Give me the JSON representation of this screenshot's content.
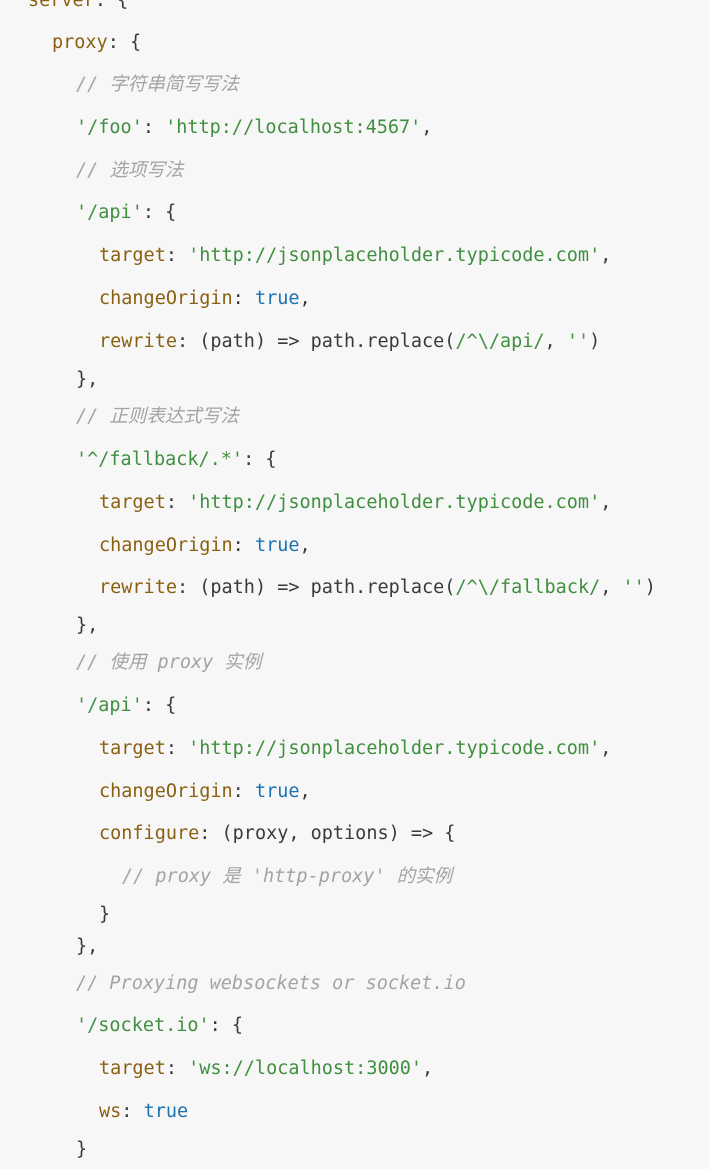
{
  "code": {
    "lines": [
      {
        "indent": 1,
        "tokens": [
          [
            "prop",
            "server"
          ],
          [
            "punc",
            ": {"
          ]
        ]
      },
      {
        "indent": 2,
        "tokens": [
          [
            "prop",
            "proxy"
          ],
          [
            "punc",
            ": {"
          ]
        ]
      },
      {
        "indent": 3,
        "tokens": [
          [
            "cmt",
            "// 字符串简写写法"
          ]
        ]
      },
      {
        "indent": 3,
        "tokens": [
          [
            "str",
            "'/foo'"
          ],
          [
            "punc",
            ": "
          ],
          [
            "str",
            "'http://localhost:4567'"
          ],
          [
            "punc",
            ","
          ]
        ]
      },
      {
        "indent": 3,
        "tokens": [
          [
            "cmt",
            "// 选项写法"
          ]
        ]
      },
      {
        "indent": 3,
        "tokens": [
          [
            "str",
            "'/api'"
          ],
          [
            "punc",
            ": {"
          ]
        ]
      },
      {
        "indent": 4,
        "tokens": [
          [
            "prop",
            "target"
          ],
          [
            "punc",
            ": "
          ],
          [
            "str",
            "'http://jsonplaceholder.typicode.com'"
          ],
          [
            "punc",
            ","
          ]
        ]
      },
      {
        "indent": 4,
        "tokens": [
          [
            "prop",
            "changeOrigin"
          ],
          [
            "punc",
            ": "
          ],
          [
            "bool",
            "true"
          ],
          [
            "punc",
            ","
          ]
        ]
      },
      {
        "indent": 4,
        "tokens": [
          [
            "prop",
            "rewrite"
          ],
          [
            "punc",
            ": "
          ],
          [
            "plain",
            "(path) => path.replace("
          ],
          [
            "str",
            "/^\\/api/"
          ],
          [
            "punc",
            ", "
          ],
          [
            "str",
            "''"
          ],
          [
            "punc",
            ")"
          ]
        ]
      },
      {
        "indent": 3,
        "tokens": [
          [
            "punc",
            "},"
          ]
        ]
      },
      {
        "indent": 3,
        "tokens": [
          [
            "cmt",
            "// 正则表达式写法"
          ]
        ]
      },
      {
        "indent": 3,
        "tokens": [
          [
            "str",
            "'^/fallback/.*'"
          ],
          [
            "punc",
            ": {"
          ]
        ]
      },
      {
        "indent": 4,
        "tokens": [
          [
            "prop",
            "target"
          ],
          [
            "punc",
            ": "
          ],
          [
            "str",
            "'http://jsonplaceholder.typicode.com'"
          ],
          [
            "punc",
            ","
          ]
        ]
      },
      {
        "indent": 4,
        "tokens": [
          [
            "prop",
            "changeOrigin"
          ],
          [
            "punc",
            ": "
          ],
          [
            "bool",
            "true"
          ],
          [
            "punc",
            ","
          ]
        ]
      },
      {
        "indent": 4,
        "tokens": [
          [
            "prop",
            "rewrite"
          ],
          [
            "punc",
            ": "
          ],
          [
            "plain",
            "(path) => path.replace("
          ],
          [
            "str",
            "/^\\/fallback/"
          ],
          [
            "punc",
            ", "
          ],
          [
            "str",
            "''"
          ],
          [
            "punc",
            ")"
          ]
        ]
      },
      {
        "indent": 3,
        "tokens": [
          [
            "punc",
            "},"
          ]
        ]
      },
      {
        "indent": 3,
        "tokens": [
          [
            "cmt",
            "// 使用 proxy 实例"
          ]
        ]
      },
      {
        "indent": 3,
        "tokens": [
          [
            "str",
            "'/api'"
          ],
          [
            "punc",
            ": {"
          ]
        ]
      },
      {
        "indent": 4,
        "tokens": [
          [
            "prop",
            "target"
          ],
          [
            "punc",
            ": "
          ],
          [
            "str",
            "'http://jsonplaceholder.typicode.com'"
          ],
          [
            "punc",
            ","
          ]
        ]
      },
      {
        "indent": 4,
        "tokens": [
          [
            "prop",
            "changeOrigin"
          ],
          [
            "punc",
            ": "
          ],
          [
            "bool",
            "true"
          ],
          [
            "punc",
            ","
          ]
        ]
      },
      {
        "indent": 4,
        "tokens": [
          [
            "prop",
            "configure"
          ],
          [
            "punc",
            ": "
          ],
          [
            "plain",
            "(proxy, options) => {"
          ]
        ]
      },
      {
        "indent": 5,
        "tokens": [
          [
            "cmt",
            "// proxy 是 'http-proxy' 的实例"
          ]
        ]
      },
      {
        "indent": 4,
        "tokens": [
          [
            "punc",
            "}"
          ]
        ]
      },
      {
        "indent": 3,
        "tokens": [
          [
            "punc",
            "},"
          ]
        ]
      },
      {
        "indent": 3,
        "tokens": [
          [
            "cmt",
            "// Proxying websockets or socket.io"
          ]
        ]
      },
      {
        "indent": 3,
        "tokens": [
          [
            "str",
            "'/socket.io'"
          ],
          [
            "punc",
            ": {"
          ]
        ]
      },
      {
        "indent": 4,
        "tokens": [
          [
            "prop",
            "target"
          ],
          [
            "punc",
            ": "
          ],
          [
            "str",
            "'ws://localhost:3000'"
          ],
          [
            "punc",
            ","
          ]
        ]
      },
      {
        "indent": 4,
        "tokens": [
          [
            "prop",
            "ws"
          ],
          [
            "punc",
            ": "
          ],
          [
            "bool",
            "true"
          ]
        ]
      },
      {
        "indent": 3,
        "tokens": [
          [
            "punc",
            "}"
          ]
        ]
      }
    ]
  }
}
